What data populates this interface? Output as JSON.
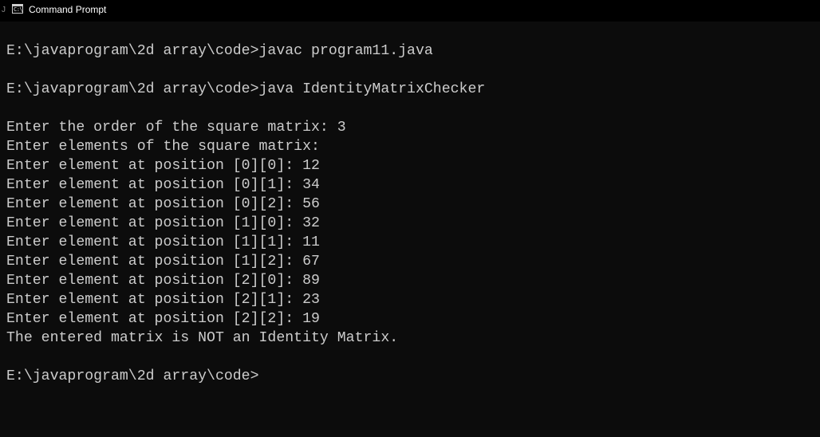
{
  "window": {
    "title": "Command Prompt",
    "edge_glyph": "J",
    "icon": "command-prompt-icon",
    "icon_text": "C:\\"
  },
  "console": {
    "lines": [
      "",
      "E:\\javaprogram\\2d array\\code>javac program11.java",
      "",
      "E:\\javaprogram\\2d array\\code>java IdentityMatrixChecker",
      "",
      "Enter the order of the square matrix: 3",
      "Enter elements of the square matrix:",
      "Enter element at position [0][0]: 12",
      "Enter element at position [0][1]: 34",
      "Enter element at position [0][2]: 56",
      "Enter element at position [1][0]: 32",
      "Enter element at position [1][1]: 11",
      "Enter element at position [1][2]: 67",
      "Enter element at position [2][0]: 89",
      "Enter element at position [2][1]: 23",
      "Enter element at position [2][2]: 19",
      "The entered matrix is NOT an Identity Matrix.",
      "",
      "E:\\javaprogram\\2d array\\code>"
    ]
  },
  "colors": {
    "background": "#0c0c0c",
    "titlebar": "#000000",
    "text": "#cccccc",
    "title_text": "#ffffff"
  }
}
